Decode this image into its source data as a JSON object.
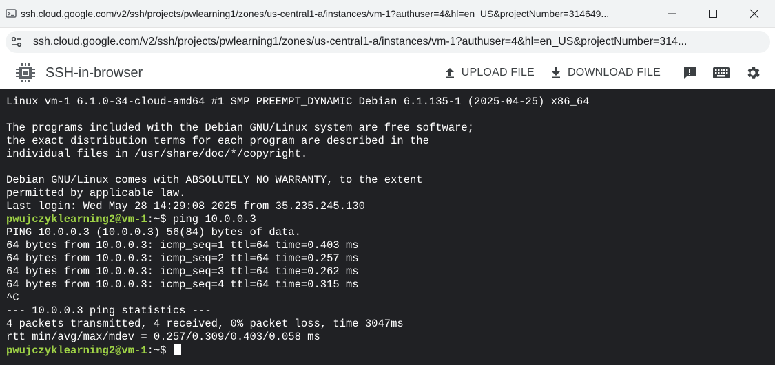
{
  "window": {
    "title": "ssh.cloud.google.com/v2/ssh/projects/pwlearning1/zones/us-central1-a/instances/vm-1?authuser=4&hl=en_US&projectNumber=314649..."
  },
  "address_bar": {
    "url": "ssh.cloud.google.com/v2/ssh/projects/pwlearning1/zones/us-central1-a/instances/vm-1?authuser=4&hl=en_US&projectNumber=314..."
  },
  "app": {
    "title": "SSH-in-browser",
    "upload_label": "UPLOAD FILE",
    "download_label": "DOWNLOAD FILE"
  },
  "terminal": {
    "lines": [
      "Linux vm-1 6.1.0-34-cloud-amd64 #1 SMP PREEMPT_DYNAMIC Debian 6.1.135-1 (2025-04-25) x86_64",
      "",
      "The programs included with the Debian GNU/Linux system are free software;",
      "the exact distribution terms for each program are described in the",
      "individual files in /usr/share/doc/*/copyright.",
      "",
      "Debian GNU/Linux comes with ABSOLUTELY NO WARRANTY, to the extent",
      "permitted by applicable law.",
      "Last login: Wed May 28 14:29:08 2025 from 35.235.245.130"
    ],
    "prompt_user_host": "pwujczyklearning2@vm-1",
    "prompt_suffix": ":~$ ",
    "command": "ping 10.0.0.3",
    "output": [
      "PING 10.0.0.3 (10.0.0.3) 56(84) bytes of data.",
      "64 bytes from 10.0.0.3: icmp_seq=1 ttl=64 time=0.403 ms",
      "64 bytes from 10.0.0.3: icmp_seq=2 ttl=64 time=0.257 ms",
      "64 bytes from 10.0.0.3: icmp_seq=3 ttl=64 time=0.262 ms",
      "64 bytes from 10.0.0.3: icmp_seq=4 ttl=64 time=0.315 ms",
      "^C",
      "--- 10.0.0.3 ping statistics ---",
      "4 packets transmitted, 4 received, 0% packet loss, time 3047ms",
      "rtt min/avg/max/mdev = 0.257/0.309/0.403/0.058 ms"
    ]
  },
  "colors": {
    "terminal_bg": "#202124",
    "prompt_green": "#9fd346"
  }
}
